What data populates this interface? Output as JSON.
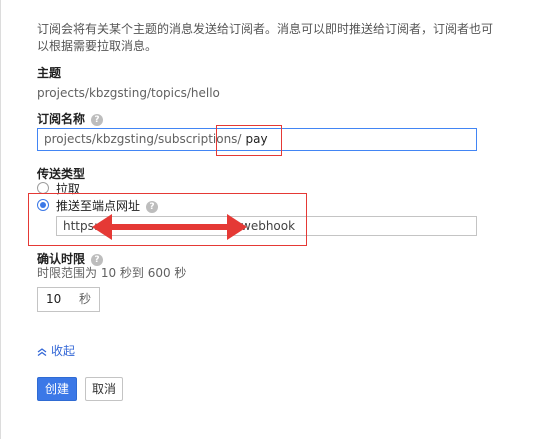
{
  "description": "订阅会将有关某个主题的消息发送给订阅者。消息可以即时推送给订阅者，订阅者也可以根据需要拉取消息。",
  "topic": {
    "label": "主题",
    "value": "projects/kbzgsting/topics/hello"
  },
  "subscription_name": {
    "label": "订阅名称",
    "prefix": "projects/kbzgsting/subscriptions/",
    "value": "pay"
  },
  "delivery": {
    "label": "传送类型",
    "options": [
      {
        "label": "拉取",
        "selected": false
      },
      {
        "label": "推送至端点网址",
        "selected": true
      }
    ],
    "endpoint": {
      "prefix": "https:",
      "suffix": "webhook"
    }
  },
  "ack": {
    "label": "确认时限",
    "hint": "时限范围为 10 秒到 600 秒",
    "value": "10",
    "unit": "秒"
  },
  "collapse_link": "收起",
  "buttons": {
    "create": "创建",
    "cancel": "取消"
  },
  "colors": {
    "accent": "#3b78e7",
    "annotation": "#e53935"
  },
  "icons": {
    "help": "help-circle-icon",
    "collapse": "chevron-up-icon",
    "annotation": "double-arrow-icon"
  }
}
